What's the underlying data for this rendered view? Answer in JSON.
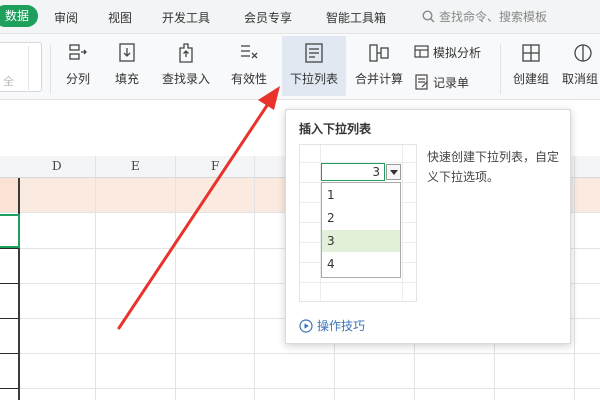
{
  "menu": {
    "active_tab": "数据",
    "tabs": [
      "审阅",
      "视图",
      "开发工具",
      "会员专享",
      "智能工具箱"
    ],
    "search_placeholder": "查找命令、搜索模板"
  },
  "ribbon": {
    "left_stub_text": "全",
    "split_label": "分列",
    "fill_label": "填充",
    "lookup_label": "查找录入",
    "validity_label": "有效性",
    "dropdown_list_label": "下拉列表",
    "consolidate_label": "合并计算",
    "whatif_label": "模拟分析",
    "record_label": "记录单",
    "group_label": "创建组",
    "ungroup_label": "取消组"
  },
  "sheet": {
    "columns": [
      "D",
      "E",
      "F"
    ]
  },
  "popup": {
    "title": "插入下拉列表",
    "preview_value": "3",
    "options": [
      "1",
      "2",
      "3",
      "4"
    ],
    "selected_option": "3",
    "description": "快速创建下拉列表，自定义下拉选项。",
    "tips_link": "操作技巧"
  },
  "colors": {
    "accent_green": "#1e9f5c",
    "annotation_arrow": "#e8322b",
    "link_blue": "#3a73b8"
  }
}
